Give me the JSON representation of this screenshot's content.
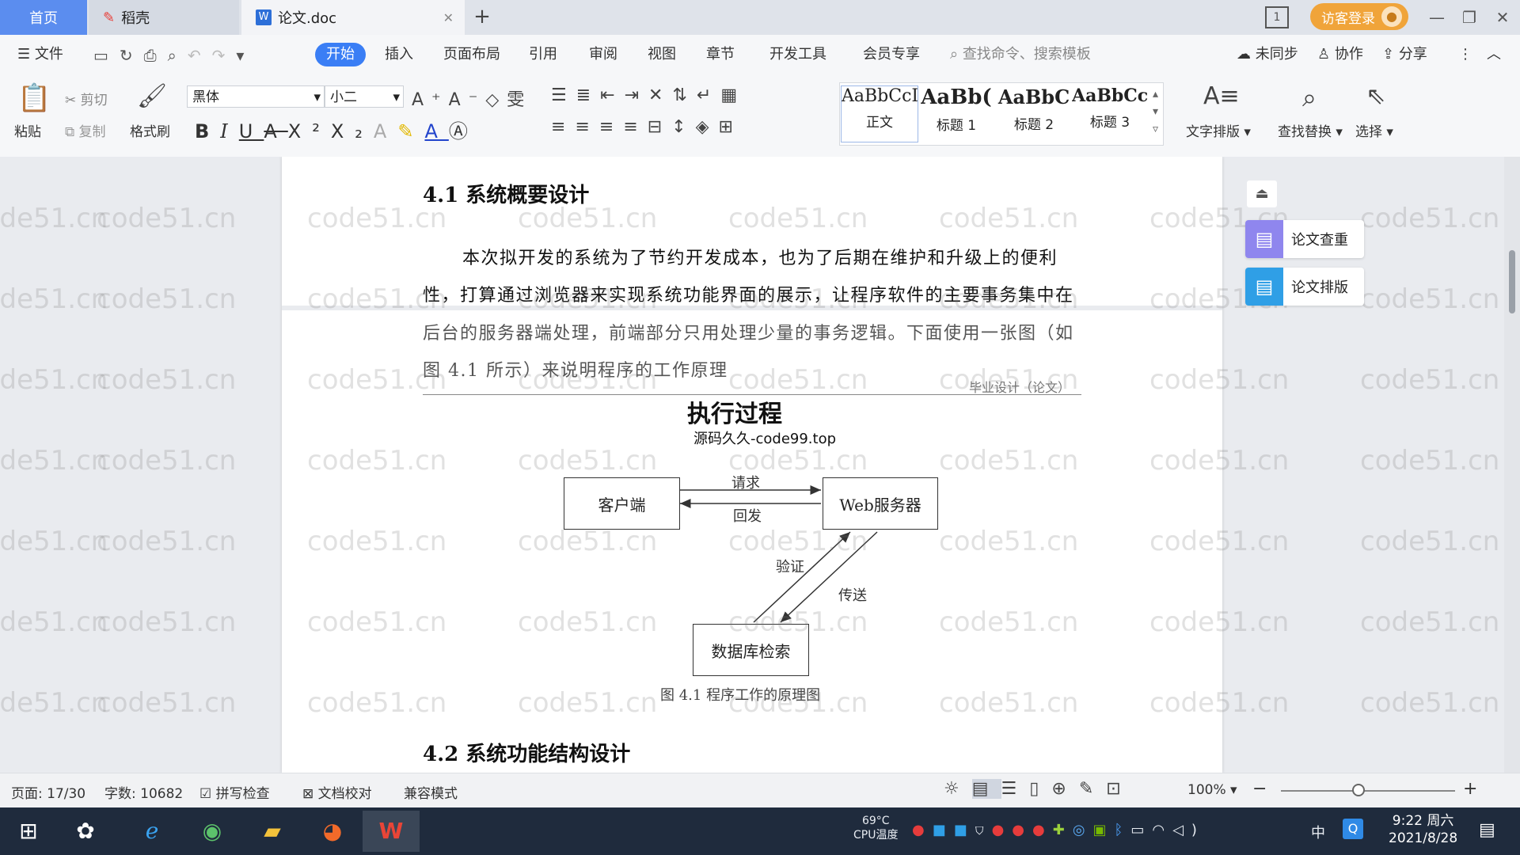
{
  "titlebar": {
    "tabs": [
      {
        "label": "首页"
      },
      {
        "label": "稻壳"
      },
      {
        "label": "论文.doc"
      }
    ],
    "login_label": "访客登录"
  },
  "menu": {
    "file": "文件",
    "items": [
      "开始",
      "插入",
      "页面布局",
      "引用",
      "审阅",
      "视图",
      "章节",
      "开发工具",
      "会员专享"
    ],
    "search_placeholder": "查找命令、搜索模板",
    "sync": "未同步",
    "collab": "协作",
    "share": "分享"
  },
  "ribbon": {
    "paste": "粘贴",
    "cut": "剪切",
    "copy": "复制",
    "format_painter": "格式刷",
    "font_name": "黑体",
    "font_size": "小二",
    "styles": [
      {
        "sample": "AaBbCcI",
        "label": "正文"
      },
      {
        "sample": "AaBb(",
        "label": "标题 1"
      },
      {
        "sample": "AaBbC",
        "label": "标题 2"
      },
      {
        "sample": "AaBbCcl",
        "label": "标题 3"
      }
    ],
    "text_layout": "文字排版",
    "find_replace": "查找替换",
    "select": "选择"
  },
  "document": {
    "watermark": "code51.cn",
    "heading1": "4.1  系统概要设计",
    "para_lines": [
      "本次拟开发的系统为了节约开发成本，也为了后期在维护和升级上的便利",
      "性，打算通过浏览器来实现系统功能界面的展示，让程序软件的主要事务集中在",
      "后台的服务器端处理，前端部分只用处理少量的事务逻辑。下面使用一张图（如",
      "图 4.1 所示）来说明程序的工作原理"
    ],
    "page_header": "毕业设计（论文）",
    "figure": {
      "title": "执行过程",
      "subtitle": "源码久久-code99.top",
      "client": "客户端",
      "server": "Web服务器",
      "database": "数据库检索",
      "request": "请求",
      "reply": "回发",
      "verify": "验证",
      "transfer": "传送",
      "caption": "图 4.1  程序工作的原理图"
    },
    "heading2": "4.2  系统功能结构设计"
  },
  "side_panel": {
    "check": "论文查重",
    "format": "论文排版"
  },
  "status": {
    "page": "页面: 17/30",
    "words": "字数: 10682",
    "spell": "拼写检查",
    "proof": "文档校对",
    "compat": "兼容模式",
    "zoom": "100%"
  },
  "taskbar": {
    "cpu_temp": "69°C",
    "cpu_label": "CPU温度",
    "ime": "中",
    "time": "9:22 周六",
    "date": "2021/8/28"
  },
  "colors": {
    "accent": "#3a7ef5",
    "login": "#f0a43a",
    "taskbar": "#1f2b3d"
  }
}
